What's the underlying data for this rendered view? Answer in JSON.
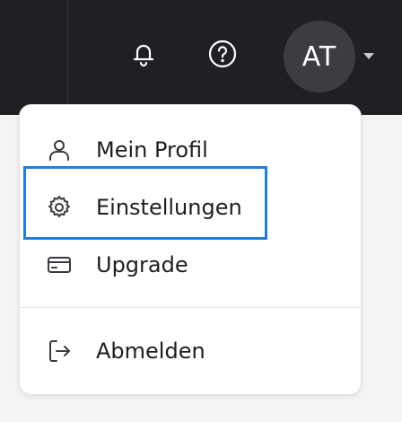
{
  "header": {
    "avatar_initials": "AT",
    "icons": {
      "notifications": "bell-icon",
      "help": "help-circle-icon",
      "account_dropdown": "caret-down-icon"
    }
  },
  "menu": {
    "items": [
      {
        "label": "Mein Profil",
        "icon": "user-icon"
      },
      {
        "label": "Einstellungen",
        "icon": "gear-icon",
        "focused": true
      },
      {
        "label": "Upgrade",
        "icon": "credit-card-icon"
      },
      {
        "label": "Abmelden",
        "icon": "logout-icon"
      }
    ]
  },
  "colors": {
    "topbar": "#1f2023",
    "avatar_bg": "#3b3d42",
    "focus_ring": "#1c7ee6",
    "menu_text": "#1e1e22"
  }
}
